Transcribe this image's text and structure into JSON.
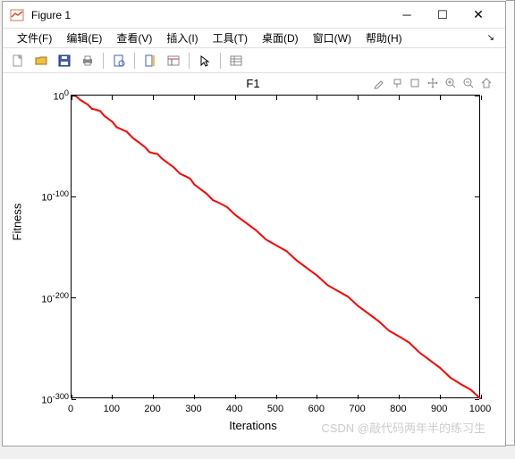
{
  "titlebar": {
    "title": "Figure 1"
  },
  "menu": {
    "file": "文件(F)",
    "edit": "编辑(E)",
    "view": "查看(V)",
    "insert": "插入(I)",
    "tools": "工具(T)",
    "desktop": "桌面(D)",
    "window": "窗口(W)",
    "help": "帮助(H)"
  },
  "chart_data": {
    "type": "line",
    "title": "F1",
    "xlabel": "Iterations",
    "ylabel": "Fitness",
    "x_range": [
      0,
      1000
    ],
    "y_log": true,
    "y_exp_range": [
      -300,
      0
    ],
    "x_ticks": [
      0,
      100,
      200,
      300,
      400,
      500,
      600,
      700,
      800,
      900,
      1000
    ],
    "y_tick_exponents": [
      0,
      -100,
      -200,
      -300
    ],
    "series": [
      {
        "name": "fitness",
        "color": "#ff0000",
        "x": [
          0,
          20,
          40,
          60,
          80,
          100,
          120,
          150,
          180,
          200,
          220,
          250,
          280,
          300,
          330,
          360,
          400,
          450,
          500,
          550,
          600,
          650,
          700,
          750,
          800,
          850,
          900,
          950,
          1000
        ],
        "y_exp": [
          0,
          -4,
          -9,
          -14,
          -20,
          -26,
          -33,
          -42,
          -51,
          -57,
          -62,
          -71,
          -80,
          -88,
          -97,
          -106,
          -118,
          -133,
          -148,
          -163,
          -178,
          -193,
          -208,
          -223,
          -238,
          -254,
          -269,
          -285,
          -300
        ]
      }
    ]
  },
  "watermark": "CSDN @敲代码两年半的练习生"
}
